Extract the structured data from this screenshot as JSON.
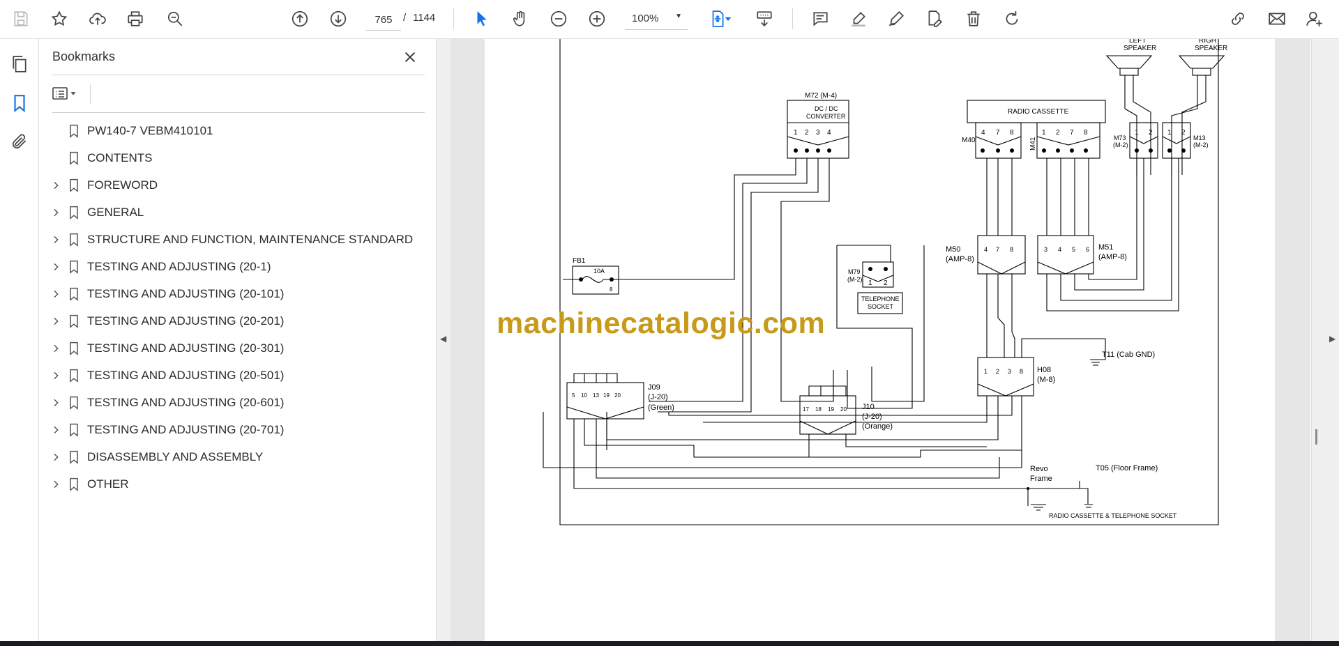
{
  "toolbar": {
    "current_page": "765",
    "page_separator": "/",
    "total_pages": "1144",
    "zoom_level": "100%",
    "accent_color": "#1473e6"
  },
  "bookmarks_panel": {
    "title": "Bookmarks",
    "items": [
      {
        "label": "PW140-7    VEBM410101",
        "expandable": false
      },
      {
        "label": "CONTENTS",
        "expandable": false
      },
      {
        "label": "FOREWORD",
        "expandable": true
      },
      {
        "label": "GENERAL",
        "expandable": true
      },
      {
        "label": "STRUCTURE AND FUNCTION, MAINTENANCE STANDARD",
        "expandable": true
      },
      {
        "label": "TESTING AND ADJUSTING (20-1)",
        "expandable": true
      },
      {
        "label": "TESTING AND ADJUSTING (20-101)",
        "expandable": true
      },
      {
        "label": "TESTING AND ADJUSTING (20-201)",
        "expandable": true
      },
      {
        "label": "TESTING AND ADJUSTING (20-301)",
        "expandable": true
      },
      {
        "label": "TESTING AND ADJUSTING (20-501)",
        "expandable": true
      },
      {
        "label": "TESTING AND ADJUSTING (20-601)",
        "expandable": true
      },
      {
        "label": "TESTING AND ADJUSTING (20-701)",
        "expandable": true
      },
      {
        "label": "DISASSEMBLY AND ASSEMBLY",
        "expandable": true
      },
      {
        "label": "OTHER",
        "expandable": true
      }
    ]
  },
  "document": {
    "watermark": "machinecatalogic.com",
    "diagram": {
      "left_speaker": [
        "LEFT",
        "SPEAKER"
      ],
      "right_speaker": [
        "RIGHT",
        "SPEAKER"
      ],
      "m72_label": "M72 (M-4)",
      "dcdc_label": [
        "DC / DC",
        "CONVERTER"
      ],
      "dcdc_pins": [
        "1",
        "2",
        "3",
        "4"
      ],
      "radio_label": "RADIO CASSETTE",
      "m40_label": "M40",
      "m40_pins": [
        "4",
        "7",
        "8"
      ],
      "m41_label": "M41",
      "m41_pins": [
        "1",
        "2",
        "7",
        "8"
      ],
      "m73_label": [
        "M73",
        "(M-2)"
      ],
      "m13_label": [
        "M13",
        "(M-2)"
      ],
      "pair_pins": [
        "1",
        "2"
      ],
      "fb1_label": "FB1",
      "fuse_rating": "10A",
      "fuse_pin": "8",
      "m79_label": [
        "M79",
        "(M-2)"
      ],
      "telephone_label": [
        "TELEPHONE",
        "SOCKET"
      ],
      "m50_label": [
        "M50",
        "(AMP-8)"
      ],
      "m50_pins": [
        "4",
        "7",
        "8"
      ],
      "m51_label": [
        "M51",
        "(AMP-8)"
      ],
      "m51_pins": [
        "3",
        "4",
        "5",
        "6"
      ],
      "j09_label": [
        "J09",
        "(J-20)",
        "(Green)"
      ],
      "j09_pins": [
        "5",
        "10",
        "13",
        "19",
        "20"
      ],
      "j10_label": [
        "J10",
        "(J-20)",
        "(Orange)"
      ],
      "j10_pins": [
        "17",
        "18",
        "19",
        "20"
      ],
      "h08_label": [
        "H08",
        "(M-8)"
      ],
      "h08_pins": [
        "1",
        "2",
        "3",
        "8"
      ],
      "t11_label": "T11 (Cab GND)",
      "revo_label": [
        "Revo",
        "Frame"
      ],
      "t05_label": "T05 (Floor Frame)",
      "caption": "RADIO CASSETTE & TELEPHONE SOCKET"
    }
  }
}
